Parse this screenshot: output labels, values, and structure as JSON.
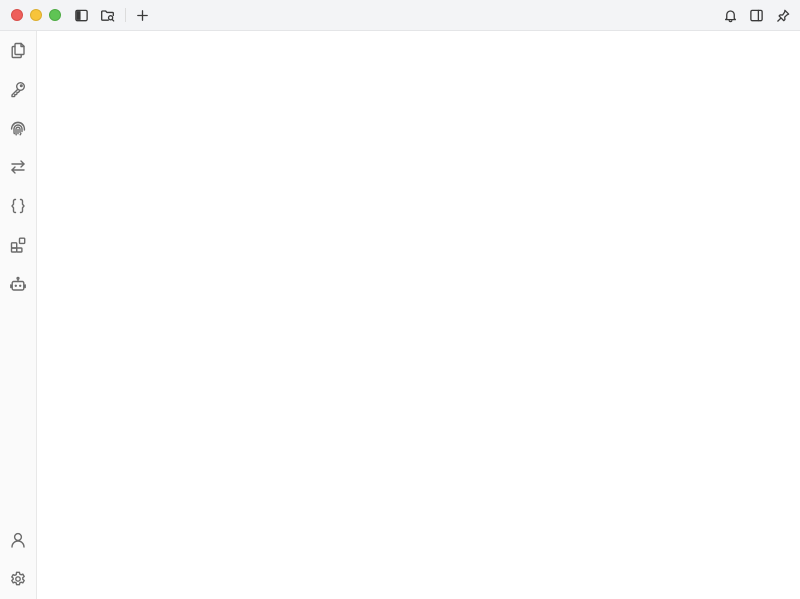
{
  "window": {
    "controls": [
      "close",
      "minimize",
      "maximize"
    ]
  },
  "toolbar": {
    "left_icons": [
      "sidebar-toggle-icon",
      "folder-search-icon",
      "plus-icon"
    ],
    "right_icons": [
      "bell-icon",
      "panel-right-icon",
      "pin-icon"
    ]
  },
  "sidebar": {
    "items": [
      {
        "icon": "files-icon"
      },
      {
        "icon": "key-icon"
      },
      {
        "icon": "fingerprint-icon"
      },
      {
        "icon": "arrows-exchange-icon"
      },
      {
        "icon": "braces-icon"
      },
      {
        "icon": "extensions-icon"
      },
      {
        "icon": "bot-icon"
      }
    ],
    "bottom_items": [
      {
        "icon": "user-icon"
      },
      {
        "icon": "settings-icon"
      }
    ]
  },
  "colors": {
    "titlebar": "#f3f4f6",
    "close": "#ee5f5b",
    "minimize": "#f7c43b",
    "maximize": "#5fc454",
    "icon": "#6b6b6b"
  }
}
